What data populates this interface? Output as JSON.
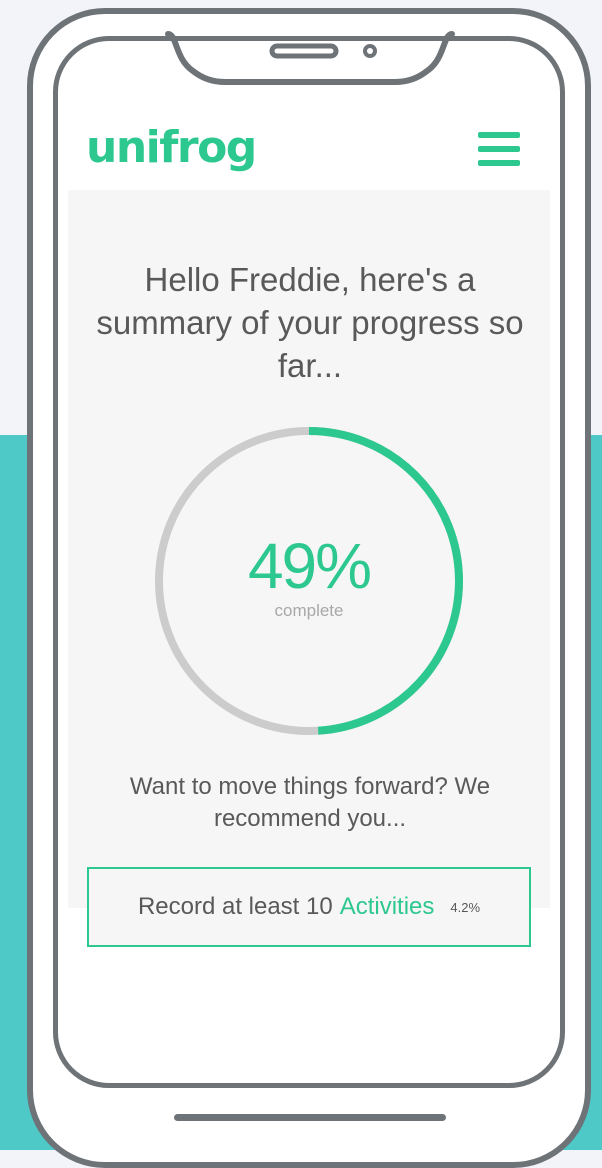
{
  "app": {
    "logo_text": "unifrog"
  },
  "header": {
    "menu_icon": "hamburger-menu-icon"
  },
  "summary": {
    "greeting": "Hello Freddie, here's a summary of your progress so far...",
    "progress_percent": 49,
    "progress_label": "49%",
    "progress_caption": "complete"
  },
  "recommendation": {
    "intro": "Want to move things forward? We recommend you...",
    "task_text": "Record at least 10",
    "task_link": "Activities",
    "task_percent": "4.2%"
  },
  "colors": {
    "brand_green": "#2dc890",
    "ring_track": "#cccccc",
    "background_teal": "#4ec9c8",
    "background_light": "#f3f4f9",
    "phone_frame": "#6e7378",
    "text_gray": "#595959"
  }
}
